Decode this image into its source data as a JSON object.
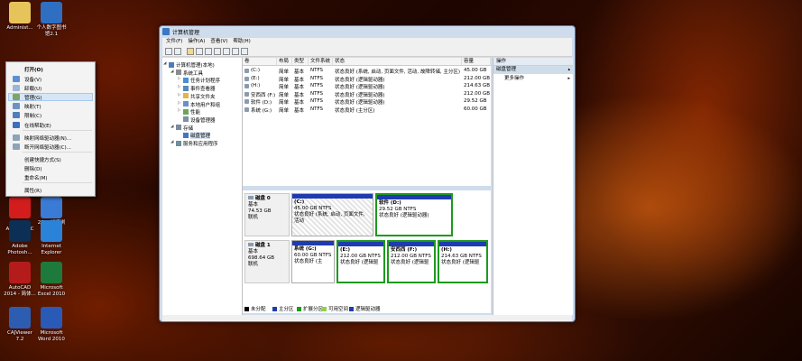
{
  "desktop": {
    "icons": [
      {
        "label": "Administ...",
        "icon": "folder-user-icon",
        "color": "#e7c45a"
      },
      {
        "label": "个人数字图书\n馆2.1",
        "icon": "library-icon",
        "color": "#2f6fc2"
      },
      {
        "label": "Adobe\nAcrobat DC",
        "icon": "acrobat-icon",
        "color": "#d31d1d"
      },
      {
        "label": "2345加速浏\n览器",
        "icon": "browser-2345-icon",
        "color": "#3a7bd5"
      },
      {
        "label": "Adobe\nPhotosh...",
        "icon": "photoshop-icon",
        "color": "#0c2f55"
      },
      {
        "label": "Internet\nExplorer",
        "icon": "ie-icon",
        "color": "#2b83d9"
      },
      {
        "label": "AutoCAD\n2014 - 简体...",
        "icon": "autocad-icon",
        "color": "#b41c1c"
      },
      {
        "label": "Microsoft\nExcel 2010",
        "icon": "excel-icon",
        "color": "#1e7a3c"
      },
      {
        "label": "CAJViewer\n7.2",
        "icon": "cajviewer-icon",
        "color": "#2d5db1"
      },
      {
        "label": "Microsoft\nWord 2010",
        "icon": "word-icon",
        "color": "#2a5ab8"
      }
    ]
  },
  "context_menu": {
    "items": [
      "打开(O)",
      "设备(V)",
      "卸载(U)",
      "管理(G)",
      "映射(T)",
      "限制(C)",
      "在线帮助(E)",
      "映射网络驱动器(N)...",
      "断开网络驱动器(C)...",
      "创建快捷方式(S)",
      "删除(D)",
      "重命名(M)",
      "属性(R)"
    ]
  },
  "window": {
    "title": "计算机管理",
    "menu": [
      "文件(F)",
      "操作(A)",
      "查看(V)",
      "帮助(H)"
    ],
    "tree": [
      {
        "label": "计算机管理(本地)",
        "level": 0
      },
      {
        "label": "系统工具",
        "level": 1
      },
      {
        "label": "任务计划程序",
        "level": 2
      },
      {
        "label": "事件查看器",
        "level": 2
      },
      {
        "label": "共享文件夹",
        "level": 2
      },
      {
        "label": "本地用户和组",
        "level": 2
      },
      {
        "label": "性能",
        "level": 2
      },
      {
        "label": "设备管理器",
        "level": 2
      },
      {
        "label": "存储",
        "level": 1
      },
      {
        "label": "磁盘管理",
        "level": 2
      },
      {
        "label": "服务和应用程序",
        "level": 1
      }
    ],
    "volume_headers": [
      "卷",
      "布局",
      "类型",
      "文件系统",
      "状态",
      "容量"
    ],
    "volumes": [
      {
        "name": "(C:)",
        "layout": "简单",
        "type": "基本",
        "fs": "NTFS",
        "status": "状态良好 (系统, 启动, 页面文件, 活动, 故障转储, 主分区)",
        "size": "45.00 GB"
      },
      {
        "name": "(E:)",
        "layout": "简单",
        "type": "基本",
        "fs": "NTFS",
        "status": "状态良好 (逻辑驱动器)",
        "size": "212.00 GB"
      },
      {
        "name": "(H:)",
        "layout": "简单",
        "type": "基本",
        "fs": "NTFS",
        "status": "状态良好 (逻辑驱动器)",
        "size": "214.63 GB"
      },
      {
        "name": "安西西 (F:)",
        "layout": "简单",
        "type": "基本",
        "fs": "NTFS",
        "status": "状态良好 (逻辑驱动器)",
        "size": "212.00 GB"
      },
      {
        "name": "软件 (D:)",
        "layout": "简单",
        "type": "基本",
        "fs": "NTFS",
        "status": "状态良好 (逻辑驱动器)",
        "size": "29.52 GB"
      },
      {
        "name": "系统 (G:)",
        "layout": "简单",
        "type": "基本",
        "fs": "NTFS",
        "status": "状态良好 (主分区)",
        "size": "60.00 GB"
      }
    ],
    "disks": [
      {
        "name": "磁盘 0",
        "type": "基本",
        "size": "74.53 GB",
        "state": "联机",
        "parts": [
          {
            "title": "(C:)",
            "size": "45.00 GB NTFS",
            "status": "状态良好 (系统, 启动, 页面文件, 活动",
            "kind": "primary"
          },
          {
            "title": "软件 (D:)",
            "size": "29.52 GB NTFS",
            "status": "状态良好 (逻辑驱动器)",
            "kind": "logical"
          }
        ]
      },
      {
        "name": "磁盘 1",
        "type": "基本",
        "size": "698.64 GB",
        "state": "联机",
        "parts": [
          {
            "title": "系统 (G:)",
            "size": "60.00 GB NTFS",
            "status": "状态良好 (主",
            "kind": "primary"
          },
          {
            "title": "(E:)",
            "size": "212.00 GB NTFS",
            "status": "状态良好 (逻辑驱",
            "kind": "logical"
          },
          {
            "title": "安西西 (F:)",
            "size": "212.00 GB NTFS",
            "status": "状态良好 (逻辑驱",
            "kind": "logical"
          },
          {
            "title": "(H:)",
            "size": "214.63 GB NTFS",
            "status": "状态良好 (逻辑驱",
            "kind": "logical"
          }
        ]
      }
    ],
    "legend": [
      {
        "label": "未分配",
        "color": "#000000"
      },
      {
        "label": "主分区",
        "color": "#1f3bb0"
      },
      {
        "label": "扩展分区",
        "color": "#1e9a1e"
      },
      {
        "label": "可用空间",
        "color": "#8fd24a"
      },
      {
        "label": "逻辑驱动器",
        "color": "#1f3bb0"
      }
    ],
    "actions": {
      "header": "操作",
      "section": "磁盘管理",
      "more": "更多操作"
    }
  }
}
